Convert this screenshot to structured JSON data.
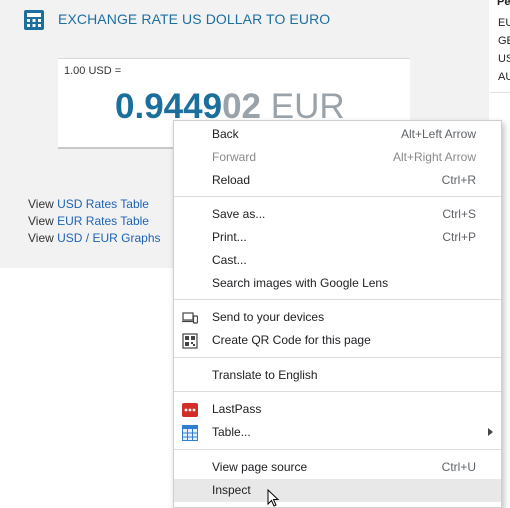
{
  "page": {
    "title": "EXCHANGE RATE US DOLLAR TO EURO",
    "rate_base": "1.00 USD =",
    "rate_main": "0.9449",
    "rate_fade": "02",
    "rate_currency": "EUR",
    "links": [
      {
        "prefix": "View",
        "label": "USD Rates Table"
      },
      {
        "prefix": "View",
        "label": "EUR Rates Table"
      },
      {
        "prefix": "View",
        "label": "USD / EUR Graphs"
      }
    ],
    "colors": {
      "accent": "#1b6f9c",
      "link": "#1d63b6"
    }
  },
  "right_column": {
    "header": "Pe",
    "rows": [
      "EU",
      "GE",
      "US",
      "AU"
    ]
  },
  "context_menu": {
    "items": [
      {
        "label": "Back",
        "shortcut": "Alt+Left Arrow"
      },
      {
        "label": "Forward",
        "shortcut": "Alt+Right Arrow",
        "disabled": true
      },
      {
        "label": "Reload",
        "shortcut": "Ctrl+R"
      },
      {
        "label": "Save as...",
        "shortcut": "Ctrl+S"
      },
      {
        "label": "Print...",
        "shortcut": "Ctrl+P"
      },
      {
        "label": "Cast..."
      },
      {
        "label": "Search images with Google Lens"
      },
      {
        "label": "Send to your devices",
        "icon": "devices-icon"
      },
      {
        "label": "Create QR Code for this page",
        "icon": "qr-code-icon"
      },
      {
        "label": "Translate to English"
      },
      {
        "label": "LastPass",
        "icon": "lastpass-icon"
      },
      {
        "label": "Table...",
        "icon": "table-icon",
        "submenu": true
      },
      {
        "label": "View page source",
        "shortcut": "Ctrl+U"
      },
      {
        "label": "Inspect",
        "hovered": true
      }
    ]
  }
}
